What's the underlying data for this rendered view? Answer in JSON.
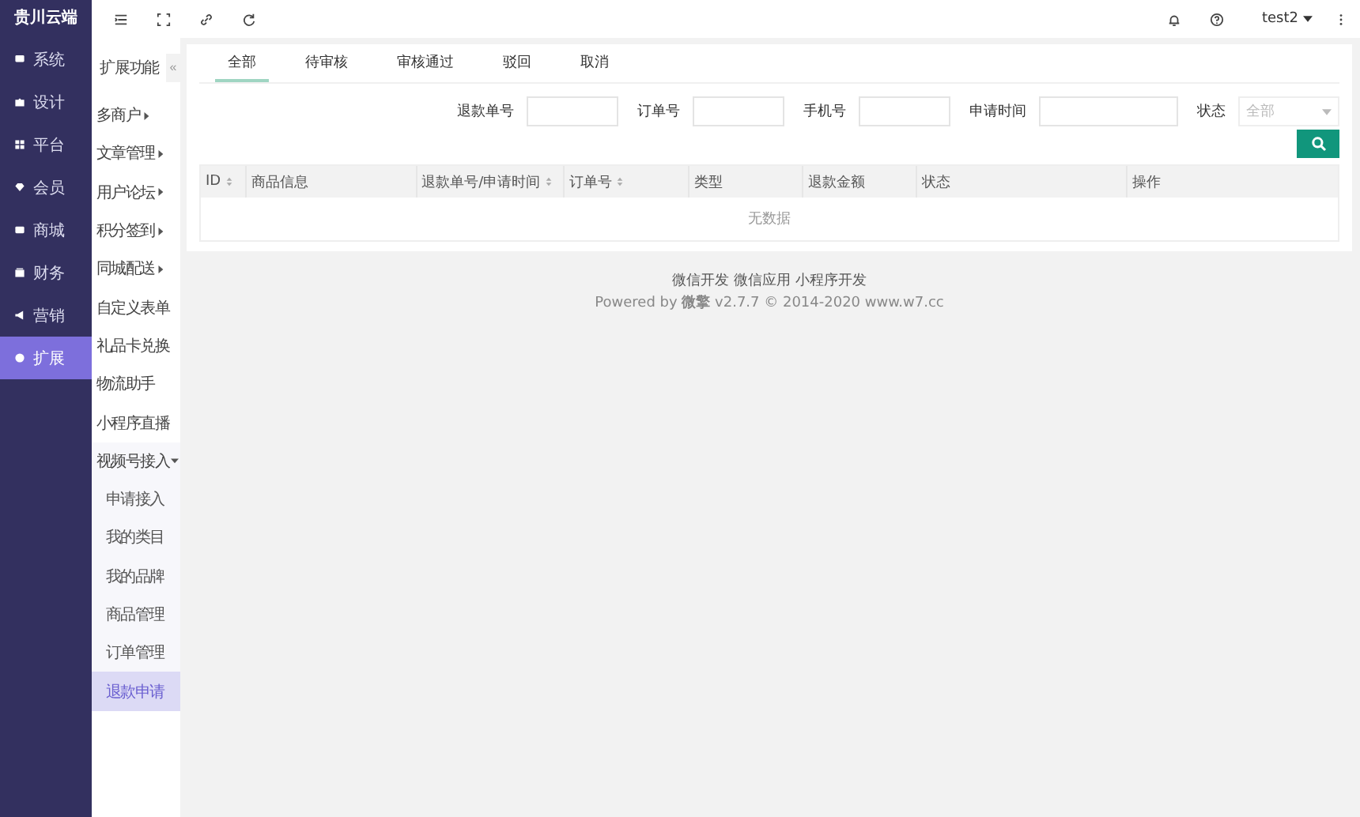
{
  "brand": "贵川云端",
  "main_nav": [
    {
      "label": "系统",
      "selected": false
    },
    {
      "label": "设计",
      "selected": false
    },
    {
      "label": "平台",
      "selected": false
    },
    {
      "label": "会员",
      "selected": false
    },
    {
      "label": "商城",
      "selected": false
    },
    {
      "label": "财务",
      "selected": false
    },
    {
      "label": "营销",
      "selected": false
    },
    {
      "label": "扩展",
      "selected": true
    }
  ],
  "sub_nav": {
    "title": "扩展功能",
    "collapse": "«",
    "items": [
      {
        "label": "多商户",
        "expanded": false
      },
      {
        "label": "文章管理",
        "expanded": false
      },
      {
        "label": "用户论坛",
        "expanded": false
      },
      {
        "label": "积分签到",
        "expanded": false
      },
      {
        "label": "同城配送",
        "expanded": false
      },
      {
        "label": "自定义表单"
      },
      {
        "label": "礼品卡兑换"
      },
      {
        "label": "物流助手"
      },
      {
        "label": "小程序直播"
      },
      {
        "label": "视频号接入",
        "expanded": true,
        "children": [
          {
            "label": "申请接入",
            "selected": false
          },
          {
            "label": "我的类目",
            "selected": false
          },
          {
            "label": "我的品牌",
            "selected": false
          },
          {
            "label": "商品管理",
            "selected": false
          },
          {
            "label": "订单管理",
            "selected": false
          },
          {
            "label": "退款申请",
            "selected": true
          }
        ]
      }
    ]
  },
  "topbar": {
    "user": "test2"
  },
  "tabs": [
    {
      "label": "全部",
      "selected": true
    },
    {
      "label": "待审核",
      "selected": false
    },
    {
      "label": "审核通过",
      "selected": false
    },
    {
      "label": "驳回",
      "selected": false
    },
    {
      "label": "取消",
      "selected": false
    }
  ],
  "filters": [
    {
      "label": "退款单号",
      "kind": "input"
    },
    {
      "label": "订单号",
      "kind": "input"
    },
    {
      "label": "手机号",
      "kind": "input"
    },
    {
      "label": "申请时间",
      "kind": "input"
    },
    {
      "label": "状态",
      "kind": "select",
      "placeholder": "全部"
    }
  ],
  "table": {
    "columns": [
      {
        "label": "ID",
        "sortable": true
      },
      {
        "label": "商品信息",
        "sortable": false
      },
      {
        "label": "退款单号/申请时间",
        "sortable": true
      },
      {
        "label": "订单号",
        "sortable": true
      },
      {
        "label": "类型",
        "sortable": false
      },
      {
        "label": "退款金额",
        "sortable": false
      },
      {
        "label": "状态",
        "sortable": false
      },
      {
        "label": "操作",
        "sortable": false
      }
    ],
    "empty": "无数据"
  },
  "footer": {
    "links": [
      "微信开发",
      "微信应用",
      "小程序开发"
    ],
    "powered": "Powered by **微擎** v2.7.7 © 2014-2020 www.w7.cc"
  }
}
